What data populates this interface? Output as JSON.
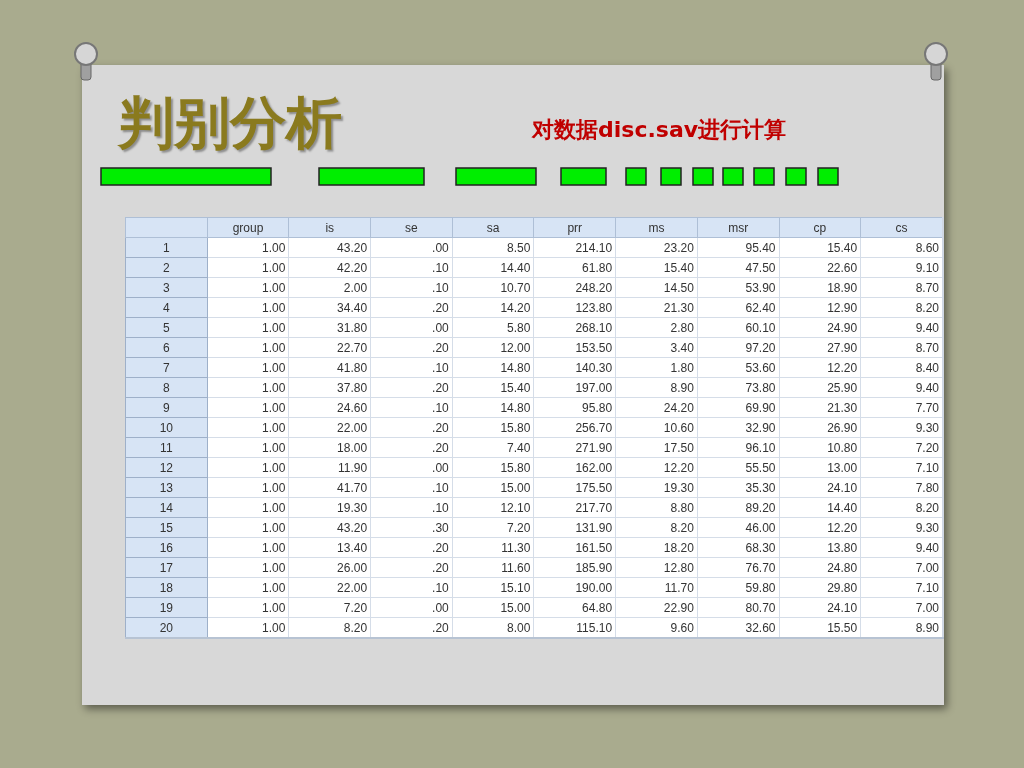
{
  "slide": {
    "title": "判别分析",
    "subtitle": "对数据disc.sav进行计算"
  },
  "table": {
    "columns": [
      "group",
      "is",
      "se",
      "sa",
      "prr",
      "ms",
      "msr",
      "cp",
      "cs"
    ],
    "rows": [
      {
        "number": "1",
        "cells": [
          "1.00",
          "43.20",
          ".00",
          "8.50",
          "214.10",
          "23.20",
          "95.40",
          "15.40",
          "8.60"
        ]
      },
      {
        "number": "2",
        "cells": [
          "1.00",
          "42.20",
          ".10",
          "14.40",
          "61.80",
          "15.40",
          "47.50",
          "22.60",
          "9.10"
        ]
      },
      {
        "number": "3",
        "cells": [
          "1.00",
          "2.00",
          ".10",
          "10.70",
          "248.20",
          "14.50",
          "53.90",
          "18.90",
          "8.70"
        ]
      },
      {
        "number": "4",
        "cells": [
          "1.00",
          "34.40",
          ".20",
          "14.20",
          "123.80",
          "21.30",
          "62.40",
          "12.90",
          "8.20"
        ]
      },
      {
        "number": "5",
        "cells": [
          "1.00",
          "31.80",
          ".00",
          "5.80",
          "268.10",
          "2.80",
          "60.10",
          "24.90",
          "9.40"
        ]
      },
      {
        "number": "6",
        "cells": [
          "1.00",
          "22.70",
          ".20",
          "12.00",
          "153.50",
          "3.40",
          "97.20",
          "27.90",
          "8.70"
        ]
      },
      {
        "number": "7",
        "cells": [
          "1.00",
          "41.80",
          ".10",
          "14.80",
          "140.30",
          "1.80",
          "53.60",
          "12.20",
          "8.40"
        ]
      },
      {
        "number": "8",
        "cells": [
          "1.00",
          "37.80",
          ".20",
          "15.40",
          "197.00",
          "8.90",
          "73.80",
          "25.90",
          "9.40"
        ]
      },
      {
        "number": "9",
        "cells": [
          "1.00",
          "24.60",
          ".10",
          "14.80",
          "95.80",
          "24.20",
          "69.90",
          "21.30",
          "7.70"
        ]
      },
      {
        "number": "10",
        "cells": [
          "1.00",
          "22.00",
          ".20",
          "15.80",
          "256.70",
          "10.60",
          "32.90",
          "26.90",
          "9.30"
        ]
      },
      {
        "number": "11",
        "cells": [
          "1.00",
          "18.00",
          ".20",
          "7.40",
          "271.90",
          "17.50",
          "96.10",
          "10.80",
          "7.20"
        ]
      },
      {
        "number": "12",
        "cells": [
          "1.00",
          "11.90",
          ".00",
          "15.80",
          "162.00",
          "12.20",
          "55.50",
          "13.00",
          "7.10"
        ]
      },
      {
        "number": "13",
        "cells": [
          "1.00",
          "41.70",
          ".10",
          "15.00",
          "175.50",
          "19.30",
          "35.30",
          "24.10",
          "7.80"
        ]
      },
      {
        "number": "14",
        "cells": [
          "1.00",
          "19.30",
          ".10",
          "12.10",
          "217.70",
          "8.80",
          "89.20",
          "14.40",
          "8.20"
        ]
      },
      {
        "number": "15",
        "cells": [
          "1.00",
          "43.20",
          ".30",
          "7.20",
          "131.90",
          "8.20",
          "46.00",
          "12.20",
          "9.30"
        ]
      },
      {
        "number": "16",
        "cells": [
          "1.00",
          "13.40",
          ".20",
          "11.30",
          "161.50",
          "18.20",
          "68.30",
          "13.80",
          "9.40"
        ]
      },
      {
        "number": "17",
        "cells": [
          "1.00",
          "26.00",
          ".20",
          "11.60",
          "185.90",
          "12.80",
          "76.70",
          "24.80",
          "7.00"
        ]
      },
      {
        "number": "18",
        "cells": [
          "1.00",
          "22.00",
          ".10",
          "15.10",
          "190.00",
          "11.70",
          "59.80",
          "29.80",
          "7.10"
        ]
      },
      {
        "number": "19",
        "cells": [
          "1.00",
          "7.20",
          ".00",
          "15.00",
          "64.80",
          "22.90",
          "80.70",
          "24.10",
          "7.00"
        ]
      },
      {
        "number": "20",
        "cells": [
          "1.00",
          "8.20",
          ".20",
          "8.00",
          "115.10",
          "9.60",
          "32.60",
          "15.50",
          "8.90"
        ]
      }
    ]
  }
}
